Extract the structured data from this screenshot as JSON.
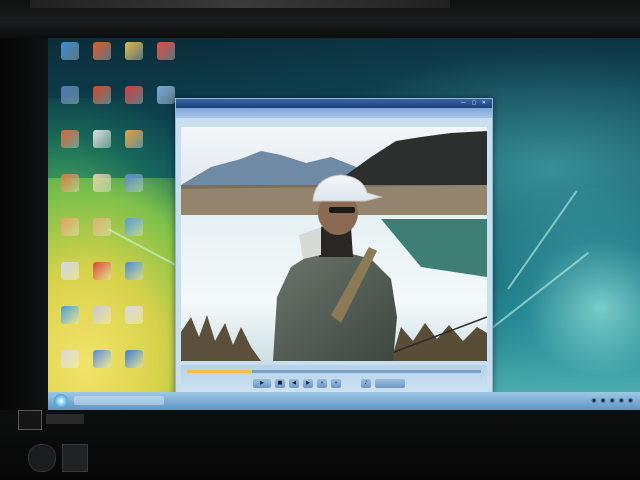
{
  "scene": {
    "description_type": "photo of a monitor showing Windows Vista desktop with media player",
    "colors": {
      "wallpaper_teal": "#1f7f8a",
      "player_chrome": "#c9dff0",
      "sky": "#e8eef4",
      "mountain": "#5f7f9a",
      "lake": "#eaf4f6",
      "jacket": "#4f5a50",
      "cap": "#e9e6dd"
    }
  },
  "desktop_icons": [
    {
      "icon": "ie-icon",
      "color": "#3a8fd8"
    },
    {
      "icon": "office-icon",
      "color": "#e25a2a"
    },
    {
      "icon": "folder-icon",
      "color": "#e6b84a"
    },
    {
      "icon": "chrome-icon",
      "color": "#e94b3c"
    },
    {
      "icon": "shield-icon",
      "color": "#4a7ab8"
    },
    {
      "icon": "office-icon",
      "color": "#d24a2a"
    },
    {
      "icon": "disc-icon",
      "color": "#d83a3a"
    },
    {
      "icon": "monitor-icon",
      "color": "#7aa8d8"
    },
    {
      "icon": "folder-icon",
      "color": "#d86a3a"
    },
    {
      "icon": "office-icon",
      "color": "#e0e0e0"
    },
    {
      "icon": "office-icon",
      "color": "#e6a04a"
    },
    {
      "icon": "folder-icon",
      "color": "#d87a3a"
    },
    {
      "icon": "office-icon",
      "color": "#e0d0a0"
    },
    {
      "icon": "people-icon",
      "color": "#5a8ac8"
    },
    {
      "icon": "folder-icon",
      "color": "#e8a060"
    },
    {
      "icon": "folder-icon",
      "color": "#e0b070"
    },
    {
      "icon": "app-icon",
      "color": "#5a9ad8"
    },
    {
      "icon": "doc-icon",
      "color": "#d0d8e8"
    },
    {
      "icon": "disc-icon",
      "color": "#d84a3a"
    },
    {
      "icon": "people-icon",
      "color": "#4a8ad8"
    },
    {
      "icon": "app-icon",
      "color": "#4a9ad8"
    },
    {
      "icon": "folder-icon",
      "color": "#c8c8d0"
    },
    {
      "icon": "doc-icon",
      "color": "#d8d8e0"
    },
    {
      "icon": "globe-icon",
      "color": "#d8d8d8"
    },
    {
      "icon": "gear-icon",
      "color": "#5a8ad8"
    },
    {
      "icon": "globe-icon",
      "color": "#3a7ad8"
    }
  ],
  "player": {
    "seek_progress": 0.22,
    "controls": [
      "play-icon",
      "stop-icon",
      "prev-icon",
      "next-icon",
      "rewind-icon",
      "forward-icon",
      "mute-icon",
      "volume-icon"
    ]
  },
  "taskbar": {
    "start_icon": "windows-orb-icon",
    "tray_icons": [
      "network-icon",
      "volume-icon",
      "security-icon"
    ]
  }
}
